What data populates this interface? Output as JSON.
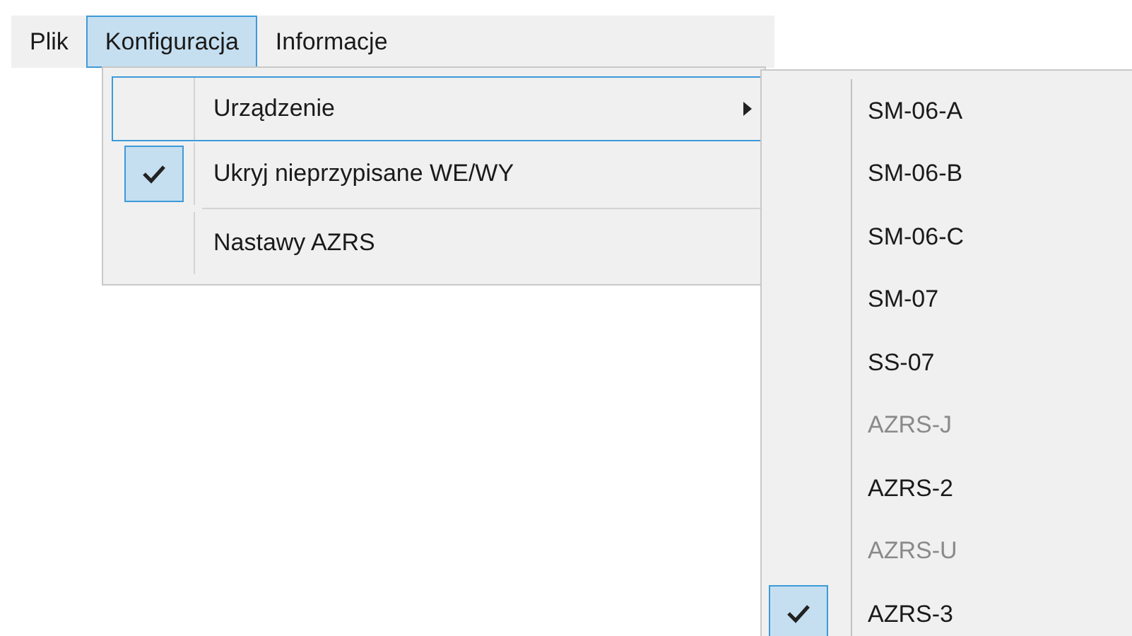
{
  "menubar": [
    {
      "label": "Plik",
      "selected": false
    },
    {
      "label": "Konfiguracja",
      "selected": true
    },
    {
      "label": "Informacje",
      "selected": false
    }
  ],
  "menu": [
    {
      "kind": "submenu",
      "label": "Urządzenie",
      "selected": true
    },
    {
      "kind": "check",
      "label": "Ukryj nieprzypisane WE/WY",
      "checked": true,
      "selected": false
    },
    {
      "kind": "separator"
    },
    {
      "kind": "item",
      "label": "Nastawy AZRS",
      "selected": false
    }
  ],
  "submenu": [
    {
      "label": "SM-06-A",
      "disabled": false,
      "checked": false
    },
    {
      "label": "SM-06-B",
      "disabled": false,
      "checked": false
    },
    {
      "label": "SM-06-C",
      "disabled": false,
      "checked": false
    },
    {
      "label": "SM-07",
      "disabled": false,
      "checked": false
    },
    {
      "label": "SS-07",
      "disabled": false,
      "checked": false
    },
    {
      "label": "AZRS-J",
      "disabled": true,
      "checked": false
    },
    {
      "label": "AZRS-2",
      "disabled": false,
      "checked": false
    },
    {
      "label": "AZRS-U",
      "disabled": true,
      "checked": false
    },
    {
      "label": "AZRS-3",
      "disabled": false,
      "checked": true
    }
  ]
}
